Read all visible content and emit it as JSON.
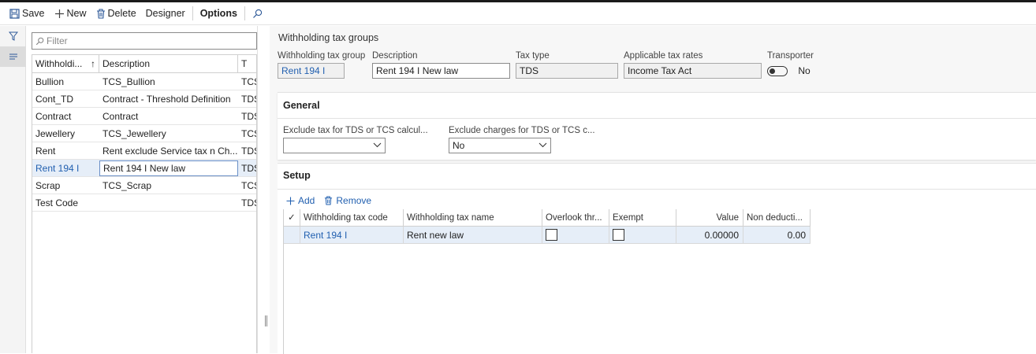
{
  "toolbar": {
    "save": "Save",
    "new": "New",
    "delete": "Delete",
    "designer": "Designer",
    "options": "Options"
  },
  "list": {
    "filter_placeholder": "Filter",
    "columns": [
      "Withholdi...",
      "Description",
      "T"
    ],
    "rows": [
      {
        "code": "Bullion",
        "desc": "TCS_Bullion",
        "type": "TCS"
      },
      {
        "code": "Cont_TD",
        "desc": "Contract - Threshold Definition",
        "type": "TDS"
      },
      {
        "code": "Contract",
        "desc": "Contract",
        "type": "TDS"
      },
      {
        "code": "Jewellery",
        "desc": "TCS_Jewellery",
        "type": "TCS"
      },
      {
        "code": "Rent",
        "desc": "Rent exclude Service tax n Ch...",
        "type": "TDS"
      },
      {
        "code": "Rent 194 I",
        "desc": "Rent 194 I New law",
        "type": "TDS"
      },
      {
        "code": "Scrap",
        "desc": "TCS_Scrap",
        "type": "TCS"
      },
      {
        "code": "Test Code",
        "desc": "",
        "type": "TDS"
      }
    ]
  },
  "detail": {
    "title": "Withholding tax groups",
    "fields": {
      "group_label": "Withholding tax group",
      "group_value": "Rent 194 I",
      "desc_label": "Description",
      "desc_value": "Rent 194 I New law",
      "taxtype_label": "Tax type",
      "taxtype_value": "TDS",
      "rates_label": "Applicable tax rates",
      "rates_value": "Income Tax Act",
      "transporter_label": "Transporter",
      "transporter_value": "No"
    },
    "general": {
      "title": "General",
      "exclude_tax_label": "Exclude tax for TDS or TCS calcul...",
      "exclude_tax_value": "",
      "exclude_charges_label": "Exclude charges for TDS or TCS c...",
      "exclude_charges_value": "No"
    },
    "setup": {
      "title": "Setup",
      "add": "Add",
      "remove": "Remove",
      "columns": [
        "Withholding tax code",
        "Withholding tax name",
        "Overlook thr...",
        "Exempt",
        "Value",
        "Non deducti..."
      ],
      "rows": [
        {
          "code": "Rent 194 I",
          "name": "Rent new law",
          "overlook": false,
          "exempt": false,
          "value": "0.00000",
          "non_deductible": "0.00"
        }
      ]
    }
  },
  "colors": {
    "accent": "#2260b0",
    "selected_row": "#e6eef8"
  }
}
